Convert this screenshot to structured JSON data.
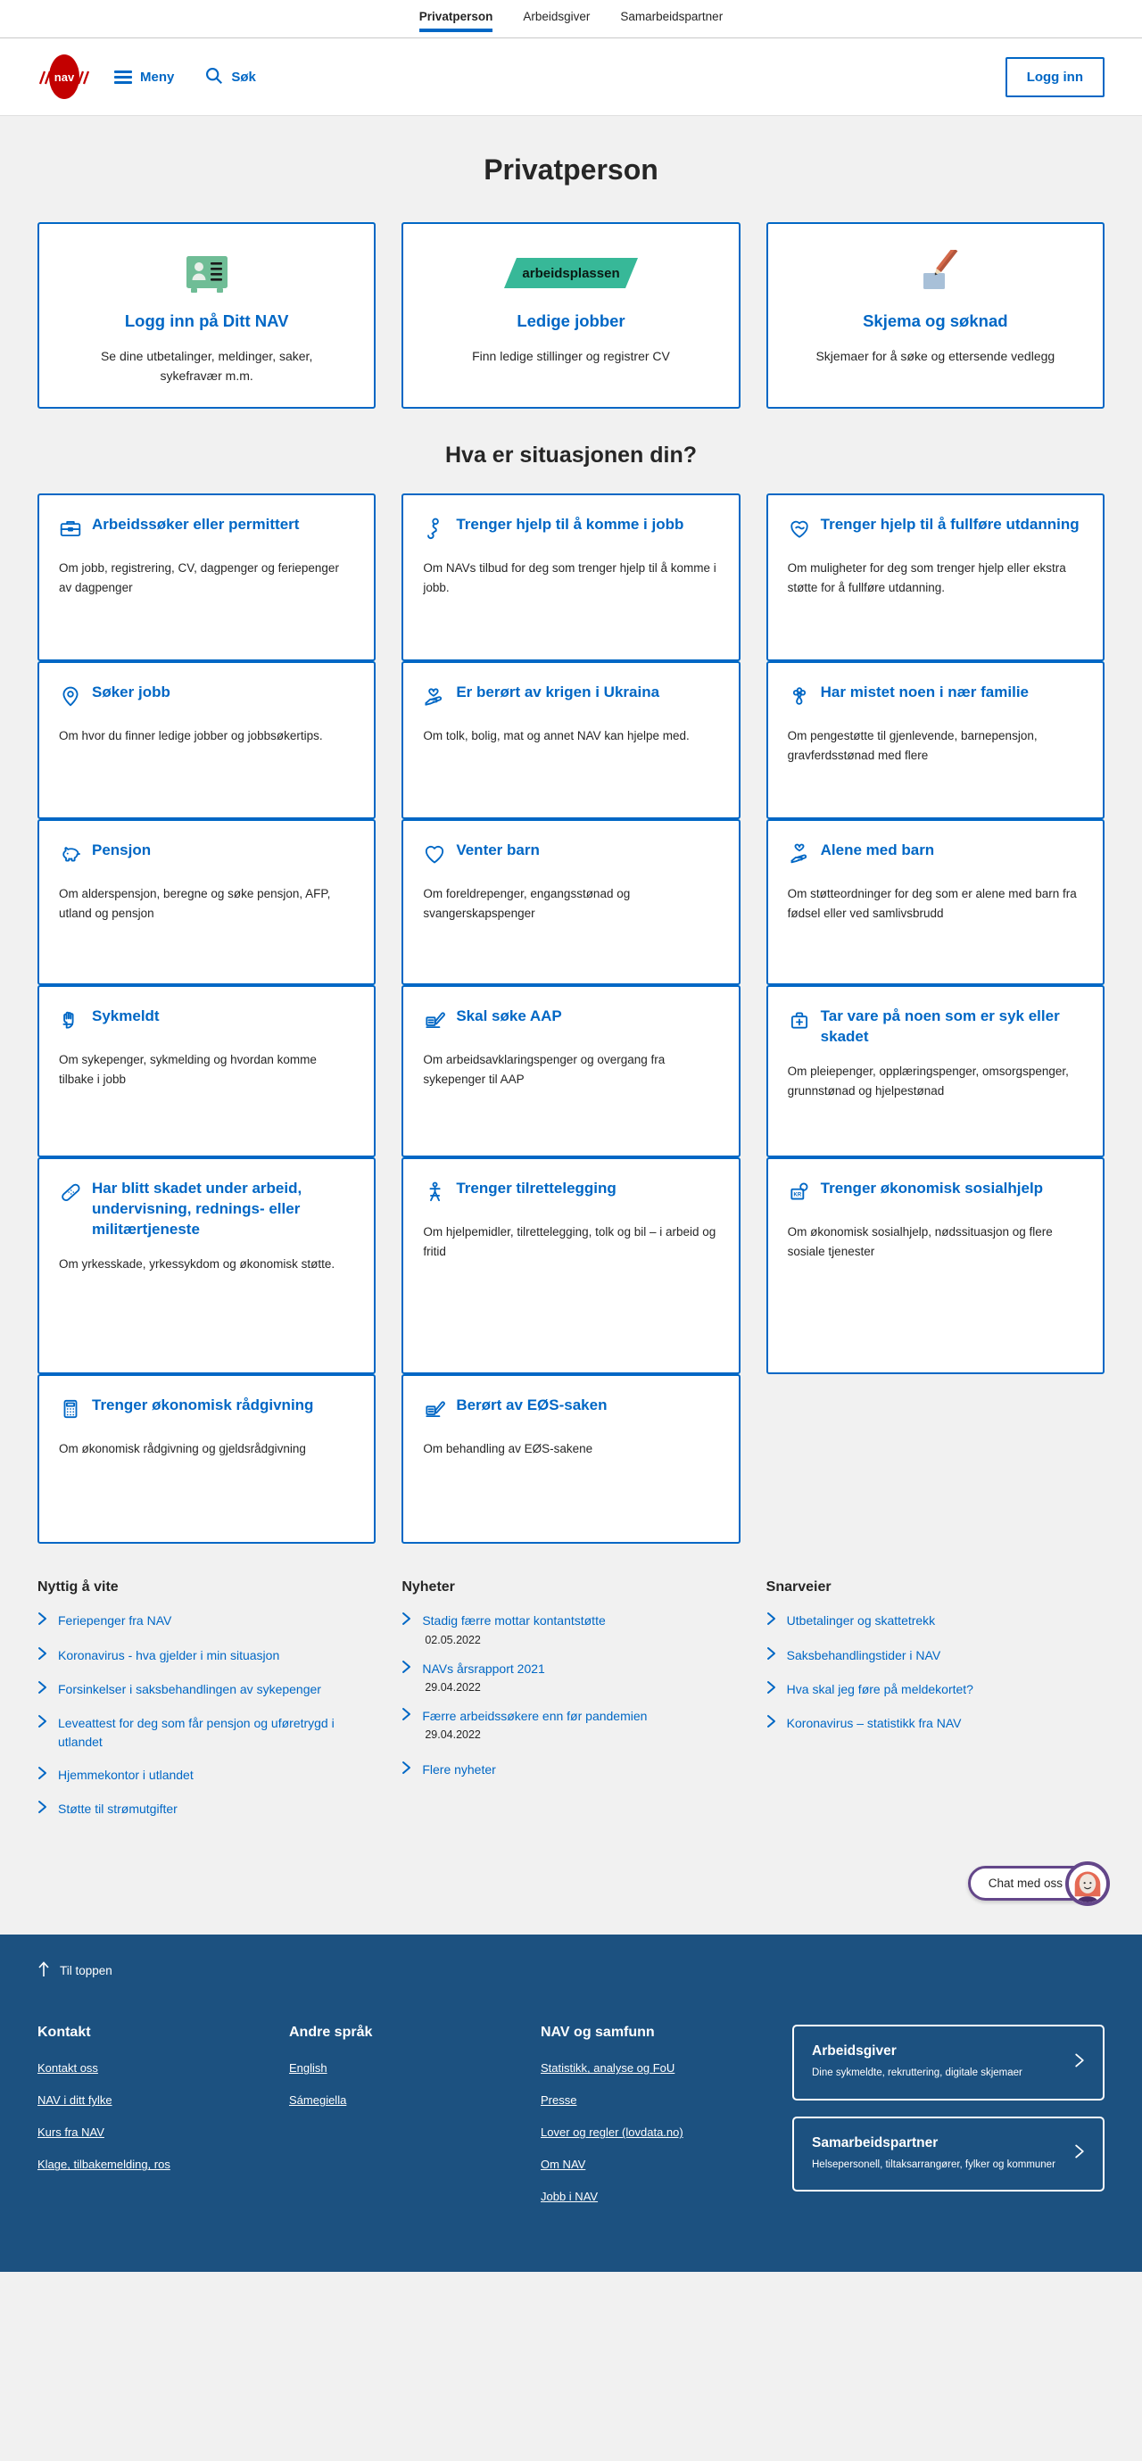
{
  "topbar": {
    "tabs": [
      {
        "label": "Privatperson",
        "active": true
      },
      {
        "label": "Arbeidsgiver",
        "active": false
      },
      {
        "label": "Samarbeidspartner",
        "active": false
      }
    ]
  },
  "header": {
    "logo_alt": "NAV",
    "menu_label": "Meny",
    "search_label": "Søk",
    "login_label": "Logg inn"
  },
  "page": {
    "title": "Privatperson",
    "section_title": "Hva er situasjonen din?"
  },
  "hero_cards": [
    {
      "icon": "id-card-icon",
      "title": "Logg inn på Ditt NAV",
      "desc": "Se dine utbetalinger, meldinger, saker, sykefravær m.m."
    },
    {
      "icon": "arbeidsplassen-logo",
      "badge_text": "arbeidsplassen",
      "title": "Ledige jobber",
      "desc": "Finn ledige stillinger og registrer CV"
    },
    {
      "icon": "pencil-paper-icon",
      "title": "Skjema og søknad",
      "desc": "Skjemaer for å søke og ettersende vedlegg"
    }
  ],
  "situation_cards": [
    {
      "icon": "briefcase-icon",
      "title": "Arbeidssøker eller permittert",
      "desc": "Om jobb, registrering, CV, dagpenger og feriepenger av dagpenger"
    },
    {
      "icon": "person-help-icon",
      "title": "Trenger hjelp til å komme i jobb",
      "desc": "Om NAVs tilbud for deg som trenger hjelp til å komme i jobb."
    },
    {
      "icon": "education-heart-icon",
      "title": "Trenger hjelp til å fullføre utdanning",
      "desc": "Om muligheter for deg som trenger hjelp eller ekstra støtte for å fullføre utdanning."
    },
    {
      "icon": "location-pin-icon",
      "title": "Søker jobb",
      "desc": "Om hvor du finner ledige jobber og jobbsøkertips."
    },
    {
      "icon": "helping-hand-heart-icon",
      "title": "Er berørt av krigen i Ukraina",
      "desc": "Om tolk, bolig, mat og annet NAV kan hjelpe med."
    },
    {
      "icon": "flower-icon",
      "title": "Har mistet noen i nær familie",
      "desc": "Om pengestøtte til gjenlevende, barnepensjon, gravferdsstønad med flere"
    },
    {
      "icon": "piggy-bank-icon",
      "title": "Pensjon",
      "desc": "Om alderspensjon, beregne og søke pensjon, AFP, utland og pensjon"
    },
    {
      "icon": "heart-icon",
      "title": "Venter barn",
      "desc": "Om foreldrepenger, engangsstønad og svangerskapspenger"
    },
    {
      "icon": "hand-heart-icon",
      "title": "Alene med barn",
      "desc": "Om støtteordninger for deg som er alene med barn fra fødsel eller ved samlivsbrudd"
    },
    {
      "icon": "bandaged-hand-icon",
      "title": "Sykmeldt",
      "desc": "Om sykepenger, sykmelding og hvordan komme tilbake i jobb"
    },
    {
      "icon": "form-pen-icon",
      "title": "Skal søke AAP",
      "desc": "Om arbeidsavklaringspenger og overgang fra sykepenger til AAP"
    },
    {
      "icon": "medical-bag-icon",
      "title": "Tar vare på noen som er syk eller skadet",
      "desc": "Om pleiepenger, opplæringspenger, omsorgspenger, grunnstønad og hjelpestønad"
    },
    {
      "icon": "bandage-icon",
      "title": "Har blitt skadet under arbeid, undervisning, rednings- eller militærtjeneste",
      "desc": "Om yrkesskade, yrkessykdom og økonomisk støtte."
    },
    {
      "icon": "accessibility-icon",
      "title": "Trenger tilrettelegging",
      "desc": "Om hjelpemidler, tilrettelegging, tolk og bil – i arbeid og fritid"
    },
    {
      "icon": "money-help-icon",
      "title": "Trenger økonomisk sosialhjelp",
      "desc": "Om økonomisk sosialhjelp, nødssituasjon og flere sosiale tjenester"
    },
    {
      "icon": "calculator-icon",
      "title": "Trenger økonomisk rådgivning",
      "desc": "Om økonomisk rådgivning og gjeldsrådgivning"
    },
    {
      "icon": "form-pen-icon",
      "title": "Berørt av EØS-saken",
      "desc": "Om behandling av EØS-sakene"
    }
  ],
  "link_columns": {
    "useful": {
      "heading": "Nyttig å vite",
      "items": [
        "Feriepenger fra NAV",
        "Koronavirus - hva gjelder i min situasjon",
        "Forsinkelser i saksbehandlingen av sykepenger",
        "Leveattest for deg som får pensjon og uføretrygd i utlandet",
        "Hjemmekontor i utlandet",
        "Støtte til strømutgifter"
      ]
    },
    "news": {
      "heading": "Nyheter",
      "items": [
        {
          "title": "Stadig færre mottar kontantstøtte",
          "date": "02.05.2022"
        },
        {
          "title": "NAVs årsrapport 2021",
          "date": "29.04.2022"
        },
        {
          "title": "Færre arbeidssøkere enn før pandemien",
          "date": "29.04.2022"
        }
      ],
      "more_label": "Flere nyheter"
    },
    "shortcuts": {
      "heading": "Snarveier",
      "items": [
        "Utbetalinger og skattetrekk",
        "Saksbehandlingstider i NAV",
        "Hva skal jeg føre på meldekortet?",
        "Koronavirus – statistikk fra NAV"
      ]
    }
  },
  "chat": {
    "label": "Chat med oss"
  },
  "footer": {
    "to_top": "Til toppen",
    "columns": [
      {
        "heading": "Kontakt",
        "links": [
          "Kontakt oss",
          "NAV i ditt fylke",
          "Kurs fra NAV",
          "Klage, tilbakemelding, ros"
        ]
      },
      {
        "heading": "Andre språk",
        "links": [
          "English",
          "Sámegiella"
        ]
      },
      {
        "heading": "NAV og samfunn",
        "links": [
          "Statistikk, analyse og FoU",
          "Presse",
          "Lover og regler (lovdata.no)",
          "Om NAV",
          "Jobb i NAV"
        ]
      }
    ],
    "promos": [
      {
        "title": "Arbeidsgiver",
        "sub": "Dine sykmeldte, rekruttering, digitale skjemaer"
      },
      {
        "title": "Samarbeidspartner",
        "sub": "Helsepersonell, tiltaksarrangører, fylker og kommuner"
      }
    ]
  },
  "colors": {
    "nav_blue": "#0067c5",
    "nav_red": "#c30000",
    "footer_blue": "#1c5180",
    "page_bg": "#f1f1f1",
    "chat_purple": "#634689",
    "green": "#59bc9c"
  }
}
